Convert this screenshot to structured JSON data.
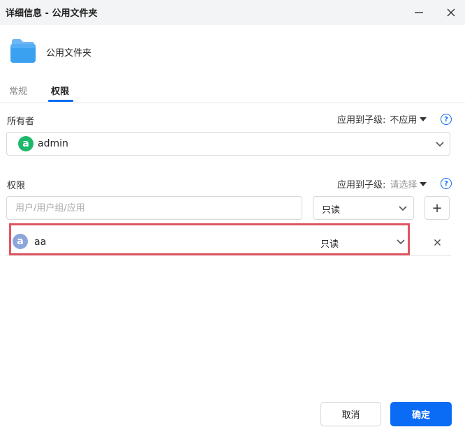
{
  "window": {
    "title": "详细信息 - 公用文件夹"
  },
  "folder": {
    "name": "公用文件夹",
    "icon": "folder-icon",
    "color": "#3aa0f0"
  },
  "tabs": [
    {
      "label": "常规",
      "active": false
    },
    {
      "label": "权限",
      "active": true
    }
  ],
  "owner": {
    "section_label": "所有者",
    "apply_label": "应用到子级:",
    "apply_value": "不应用",
    "avatar_letter": "a",
    "user": "admin"
  },
  "permissions": {
    "section_label": "权限",
    "apply_label": "应用到子级:",
    "apply_value": "请选择",
    "input_placeholder": "用户/用户组/应用",
    "new_permission": "只读",
    "add_symbol": "+",
    "entries": [
      {
        "avatar_letter": "a",
        "name": "aa",
        "permission": "只读"
      }
    ]
  },
  "help_symbol": "?",
  "buttons": {
    "cancel": "取消",
    "confirm": "确定"
  },
  "colors": {
    "accent": "#0a6cf5",
    "owner_avatar": "#1db86a",
    "user_avatar": "#8ca6db",
    "highlight": "#e05561"
  }
}
